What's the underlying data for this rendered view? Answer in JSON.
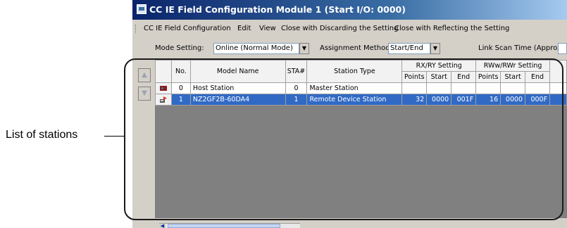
{
  "callout": {
    "label": "List of stations"
  },
  "window": {
    "title": "CC IE Field Configuration Module 1 (Start I/O: 0000)",
    "icon": "app-window-icon"
  },
  "menu": [
    "CC IE Field Configuration",
    "Edit",
    "View",
    "Close with Discarding the Setting",
    "Close with Reflecting the Setting"
  ],
  "settings": {
    "mode_label": "Mode Setting:",
    "mode_value": "Online (Normal Mode)",
    "assignment_label": "Assignment Method:",
    "assignment_value": "Start/End",
    "link_scan_label": "Link Scan Time (Approx.):"
  },
  "nav": {
    "up_icon": "arrow-up-icon",
    "down_icon": "arrow-down-icon",
    "up_glyph": "▲",
    "down_glyph": "▼"
  },
  "table": {
    "headers": {
      "no": "No.",
      "model": "Model Name",
      "sta": "STA#",
      "type": "Station Type",
      "rxry": "RX/RY Setting",
      "rwwrwr": "RWw/RWr Setting",
      "points": "Points",
      "start": "Start",
      "end": "End"
    },
    "rows": [
      {
        "icon": "host-station-icon",
        "no": "0",
        "model": "Host Station",
        "sta": "0",
        "type": "Master Station",
        "rx_points": "",
        "rx_start": "",
        "rx_end": "",
        "rw_points": "",
        "rw_start": "",
        "rw_end": ""
      },
      {
        "icon": "remote-device-station-icon",
        "no": "1",
        "model": "NZ2GF2B-60DA4",
        "sta": "1",
        "type": "Remote Device Station",
        "rx_points": "32",
        "rx_start": "0000",
        "rx_end": "001F",
        "rw_points": "16",
        "rw_start": "0000",
        "rw_end": "000F"
      }
    ]
  },
  "colors": {
    "selection": "#316ac5",
    "title_gradient_start": "#0a246a",
    "grid_background": "#808080"
  }
}
